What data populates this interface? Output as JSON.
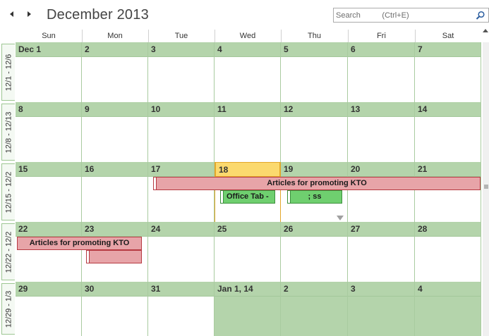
{
  "header": {
    "title": "December 2013",
    "search_placeholder": "Search          (Ctrl+E)"
  },
  "day_names": [
    "Sun",
    "Mon",
    "Tue",
    "Wed",
    "Thu",
    "Fri",
    "Sat"
  ],
  "week_labels": [
    "12/1 - 12/6",
    "12/8 - 12/13",
    "12/15 - 12/2",
    "12/22 - 12/2",
    "12/29 - 1/3"
  ],
  "weeks": [
    [
      "Dec 1",
      "2",
      "3",
      "4",
      "5",
      "6",
      "7"
    ],
    [
      "8",
      "9",
      "10",
      "11",
      "12",
      "13",
      "14"
    ],
    [
      "15",
      "16",
      "17",
      "18",
      "19",
      "20",
      "21"
    ],
    [
      "22",
      "23",
      "24",
      "25",
      "26",
      "27",
      "28"
    ],
    [
      "29",
      "30",
      "31",
      "Jan 1, 14",
      "2",
      "3",
      "4"
    ]
  ],
  "today": "18",
  "events": {
    "articles_week3": "Articles for promoting KTO",
    "office_tab": "Office Tab -",
    "thu_event": "; ss",
    "articles_week4": "Articles for promoting KTO",
    "mon_event": ""
  },
  "colors": {
    "green_band": "#b4d4ab",
    "today_fill": "#fbd96e",
    "red_event": "#e7a4a8",
    "green_event": "#6fcf6f"
  }
}
